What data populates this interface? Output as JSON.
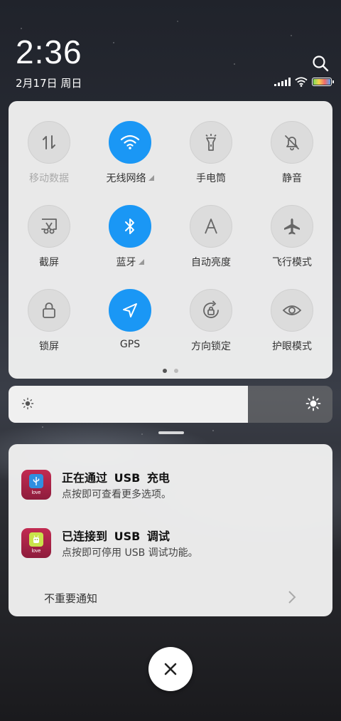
{
  "status_bar": {
    "time": "2:36",
    "date": "2月17日 周日",
    "battery_level": 1.0
  },
  "quick_settings": {
    "tiles": [
      {
        "label": "移动数据",
        "icon": "mobile-data-icon",
        "active": false,
        "dim": true
      },
      {
        "label": "无线网络",
        "icon": "wifi-icon",
        "active": true,
        "expand": true
      },
      {
        "label": "手电筒",
        "icon": "flashlight-icon",
        "active": false
      },
      {
        "label": "静音",
        "icon": "mute-bell-icon",
        "active": false
      },
      {
        "label": "截屏",
        "icon": "screenshot-icon",
        "active": false
      },
      {
        "label": "蓝牙",
        "icon": "bluetooth-icon",
        "active": true,
        "expand": true
      },
      {
        "label": "自动亮度",
        "icon": "auto-brightness-icon",
        "active": false
      },
      {
        "label": "飞行模式",
        "icon": "airplane-icon",
        "active": false
      },
      {
        "label": "锁屏",
        "icon": "lock-icon",
        "active": false
      },
      {
        "label": "GPS",
        "icon": "gps-icon",
        "active": true
      },
      {
        "label": "方向锁定",
        "icon": "rotation-lock-icon",
        "active": false
      },
      {
        "label": "护眼模式",
        "icon": "eye-icon",
        "active": false
      }
    ],
    "page_count": 2,
    "current_page": 1
  },
  "brightness": {
    "level": 0.74
  },
  "notifications": [
    {
      "title": "正在通过 USB 充电",
      "body": "点按即可查看更多选项。",
      "icon": "usb-icon"
    },
    {
      "title": "已连接到 USB 调试",
      "body": "点按即可停用 USB 调试功能。",
      "icon": "android-icon"
    }
  ],
  "unimportant_label": "不重要通知",
  "colors": {
    "accent": "#1a97f5",
    "tile_off": "#dcdcdc",
    "panel": "#f0f0f0"
  }
}
